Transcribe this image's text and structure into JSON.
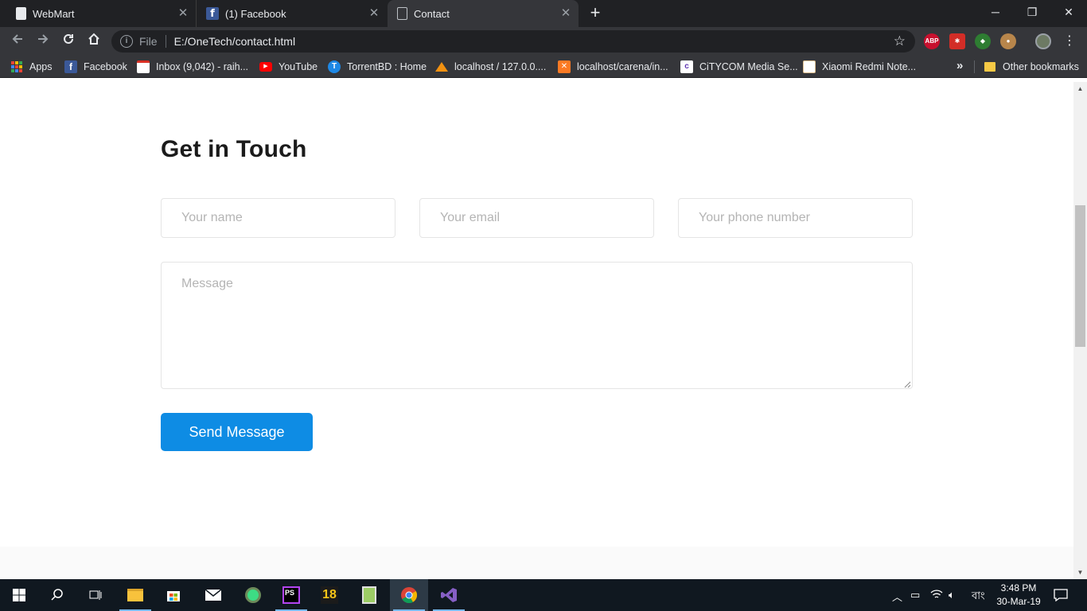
{
  "browser": {
    "tabs": [
      {
        "title": "WebMart",
        "icon": "document-icon",
        "active": false
      },
      {
        "title": "(1) Facebook",
        "icon": "facebook-icon",
        "active": false
      },
      {
        "title": "Contact",
        "icon": "document-icon",
        "active": true
      }
    ],
    "omnibox": {
      "scheme_label": "File",
      "url": "E:/OneTech/contact.html"
    },
    "extensions": [
      "abp-icon",
      "lastpass-icon",
      "extension-icon",
      "cookie-icon"
    ],
    "bookmarks": [
      {
        "label": "Apps",
        "icon": "apps-grid-icon"
      },
      {
        "label": "Facebook",
        "icon": "facebook-icon"
      },
      {
        "label": "Inbox (9,042) - raih...",
        "icon": "gmail-icon"
      },
      {
        "label": "YouTube",
        "icon": "youtube-icon"
      },
      {
        "label": "TorrentBD : Home",
        "icon": "torrentbd-icon"
      },
      {
        "label": "localhost / 127.0.0....",
        "icon": "phpmyadmin-icon"
      },
      {
        "label": "localhost/carena/in...",
        "icon": "xampp-icon"
      },
      {
        "label": "CiTYCOM Media Se...",
        "icon": "citycom-icon"
      },
      {
        "label": "Xiaomi Redmi Note...",
        "icon": "xiaomi-icon"
      }
    ],
    "bookmarks_overflow": "»",
    "other_bookmarks": "Other bookmarks"
  },
  "page": {
    "title": "Get in Touch",
    "form": {
      "name_placeholder": "Your name",
      "email_placeholder": "Your email",
      "phone_placeholder": "Your phone number",
      "message_placeholder": "Message",
      "submit_label": "Send Message"
    }
  },
  "taskbar": {
    "apps": [
      "start-icon",
      "search-icon",
      "task-view-icon",
      "file-explorer-icon",
      "store-icon",
      "mail-icon",
      "android-studio-icon",
      "phpstorm-icon",
      "app-18-icon",
      "notepad-icon",
      "chrome-icon",
      "visual-studio-icon"
    ],
    "language": "বাং",
    "time": "3:48 PM",
    "date": "30-Mar-19"
  },
  "colors": {
    "accent_button": "#0e8ce4",
    "tab_strip": "#202124",
    "toolbar": "#35363a",
    "taskbar": "#101820"
  }
}
